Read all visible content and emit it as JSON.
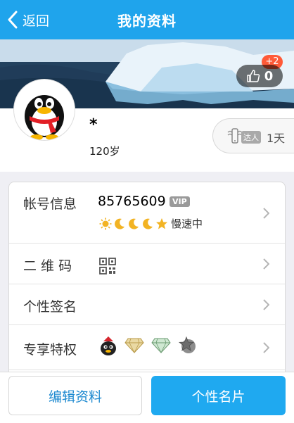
{
  "nav": {
    "back_label": "返回",
    "title": "我的资料"
  },
  "likes": {
    "count": "0",
    "badge": "+2"
  },
  "profile": {
    "nickname": "*",
    "age": "120岁"
  },
  "daren": {
    "tag": "达人",
    "days": "1天"
  },
  "rows": {
    "account": {
      "label": "帐号信息",
      "number": "85765609",
      "vip": "VIP",
      "status": "慢速中",
      "level_icons": [
        "sun-icon",
        "moon-icon",
        "moon-icon",
        "moon-icon",
        "star-icon"
      ]
    },
    "qrcode": {
      "label": "二 维 码"
    },
    "signature": {
      "label": "个性签名"
    },
    "privileges": {
      "label": "专享特权",
      "icons": [
        "penguin-badge-icon",
        "gold-diamond-icon",
        "green-diamond-icon",
        "star-medal-icon"
      ]
    }
  },
  "actions": {
    "edit": "编辑资料",
    "card": "个性名片"
  },
  "colors": {
    "nav": "#1fa4ec",
    "primary_button": "#1fa9f0",
    "link_text": "#1f8ad0",
    "badge": "#ff5a38"
  }
}
